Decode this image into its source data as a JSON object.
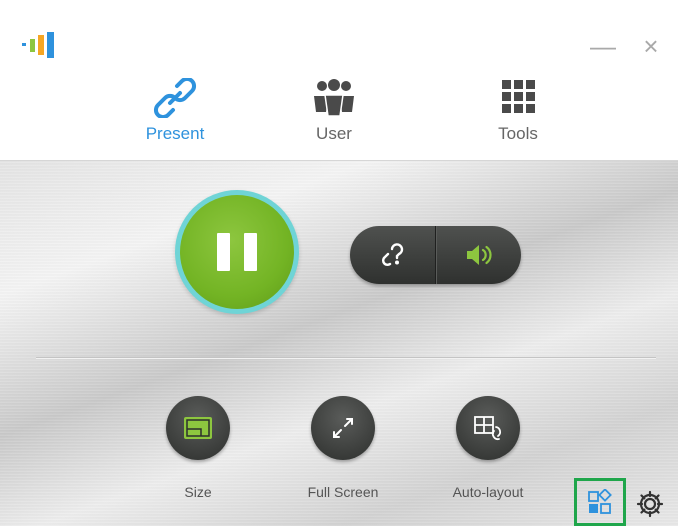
{
  "window": {
    "minimize_symbol": "—",
    "close_symbol": "×"
  },
  "tabs": [
    {
      "label": "Present",
      "icon": "link-icon",
      "active": true
    },
    {
      "label": "User",
      "icon": "users-icon",
      "active": false
    },
    {
      "label": "Tools",
      "icon": "grid-icon",
      "active": false
    }
  ],
  "controls": {
    "main_state": "pause",
    "left_pill_icon": "unlink-icon",
    "right_pill_icon": "speaker-icon"
  },
  "tools": [
    {
      "label": "Size",
      "icon": "size-icon"
    },
    {
      "label": "Full Screen",
      "icon": "fullscreen-icon"
    },
    {
      "label": "Auto-layout",
      "icon": "auto-layout-icon"
    }
  ],
  "colors": {
    "accent": "#2e92dd",
    "play_green": "#73b424",
    "play_ring": "#6fd4d6",
    "highlight": "#1fa64b",
    "dark_button": "#3b3d3b"
  }
}
